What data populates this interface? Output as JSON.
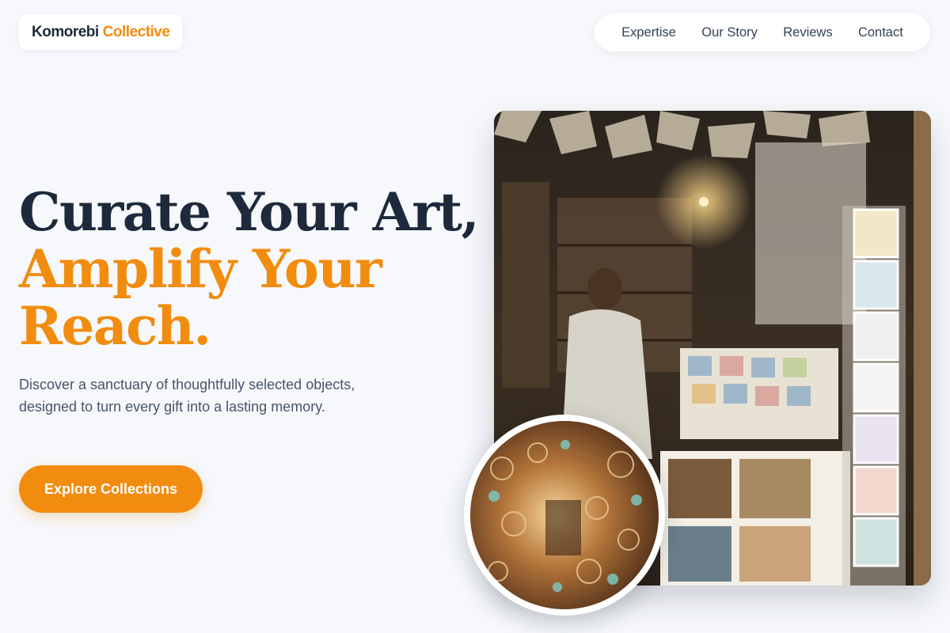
{
  "brand": {
    "name_part1": "Komorebi",
    "name_part2": "Collective"
  },
  "nav": {
    "items": [
      "Expertise",
      "Our Story",
      "Reviews",
      "Contact"
    ]
  },
  "hero": {
    "line1": "Curate Your Art,",
    "line2": "Amplify Your",
    "line3": "Reach.",
    "subtitle": "Discover a sanctuary of thoughtfully selected objects, designed to turn every gift into a lasting memory.",
    "cta": "Explore Collections"
  },
  "images": {
    "main": "bookshop-interior-photo",
    "inset": "hanging-lanterns-photo"
  },
  "colors": {
    "accent": "#f28c0f",
    "text": "#1e293b",
    "muted": "#475569",
    "background": "#f6f8fb"
  }
}
